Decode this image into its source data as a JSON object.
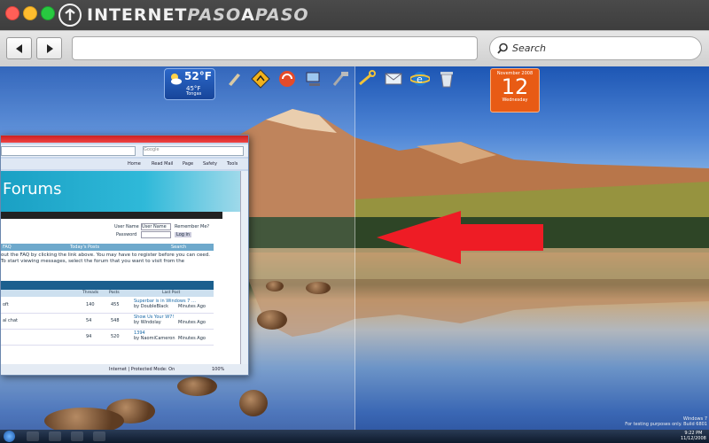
{
  "window": {
    "brand_text_a": "INTERNET",
    "brand_text_b": "PASO",
    "brand_text_c": "A",
    "brand_text_d": "PASO"
  },
  "toolbar": {
    "back_icon": "left-arrow-icon",
    "forward_icon": "right-arrow-icon",
    "url_value": "",
    "search_placeholder": "Search"
  },
  "desktop": {
    "weather": {
      "temp": "52°F",
      "range": "45°F",
      "location": "Tongas"
    },
    "calendar": {
      "month": "November 2008",
      "day": "12",
      "weekday": "Wednesday"
    },
    "gadget_icons": [
      "pen-icon",
      "road-sign-icon",
      "tools-icon",
      "network-icon",
      "hammer-icon",
      "wrench-icon",
      "mail-icon",
      "ie-icon",
      "recycle-bin-icon"
    ]
  },
  "ie_window": {
    "search_text": "Google",
    "commands": [
      "Home",
      "Read Mail",
      "Page",
      "Safety",
      "Tools"
    ],
    "banner_title": "Forums",
    "login": {
      "user_label": "User Name",
      "user_placeholder": "User Name",
      "remember": "Remember Me?",
      "password_label": "Password",
      "login_btn": "Log in"
    },
    "header_cols": [
      "FAQ",
      "Today's Posts",
      "Search"
    ],
    "welcome_text": "out the FAQ by clicking the link above. You may have to register before you can ceed. To start viewing messages, select the forum that you want to visit from the",
    "forum_cols": [
      "Threads",
      "Posts",
      "Last Post"
    ],
    "rows": [
      {
        "name": "oft",
        "threads": "140",
        "posts": "455",
        "last_title": "Superbar is in Windows 7 …",
        "last_by": "by DoubleBlack",
        "last_time": "Minutes Ago"
      },
      {
        "name": "al chat",
        "threads": "54",
        "posts": "548",
        "last_title": "Show Us Your W7!",
        "last_by": "by Windolay",
        "last_time": "Minutes Ago"
      },
      {
        "name": "",
        "threads": "94",
        "posts": "520",
        "last_title": "1394",
        "last_by": "by NaomiCameron",
        "last_time": "Minutes Ago"
      }
    ],
    "status_text": "Internet | Protected Mode: On",
    "zoom": "100%"
  },
  "watermark": {
    "line1": "Windows 7",
    "line2": "For testing purposes only. Build 6801"
  },
  "taskbar": {
    "time": "9:22 PM",
    "date": "11/12/2008"
  },
  "colors": {
    "arrow": "#ee1c25",
    "calendar": "#e85b15",
    "chrome_dark": "#3a3a3a"
  }
}
